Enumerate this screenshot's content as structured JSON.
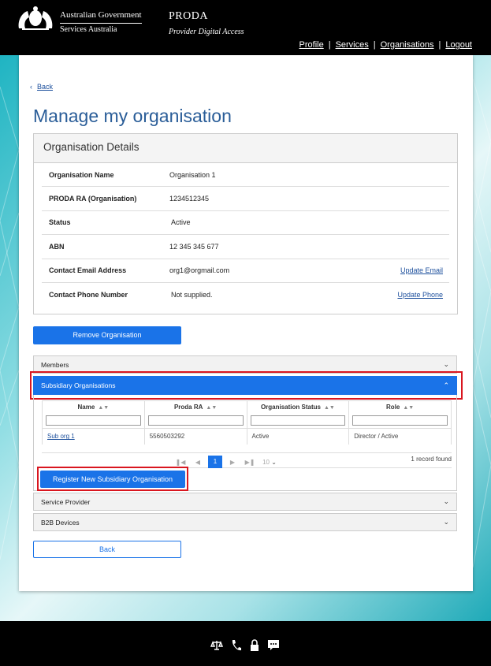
{
  "header": {
    "gov_line1": "Australian Government",
    "gov_line2": "Services Australia",
    "app_title": "PRODA",
    "app_subtitle": "Provider Digital Access",
    "nav": [
      "Profile",
      "Services",
      "Organisations",
      "Logout"
    ]
  },
  "page": {
    "back_link": "Back",
    "title": "Manage my organisation"
  },
  "details": {
    "heading": "Organisation Details",
    "rows": [
      {
        "label": "Organisation Name",
        "value": "Organisation 1",
        "action": ""
      },
      {
        "label": "PRODA RA (Organisation)",
        "value": "1234512345",
        "action": ""
      },
      {
        "label": "Status",
        "value": "Active",
        "action": ""
      },
      {
        "label": "ABN",
        "value": "12 345 345 677",
        "action": ""
      },
      {
        "label": "Contact Email Address",
        "value": "org1@orgmail.com",
        "action": "Update Email"
      },
      {
        "label": "Contact Phone Number",
        "value": "Not supplied.",
        "action": "Update Phone"
      }
    ]
  },
  "remove_button": "Remove Organisation",
  "accordions": {
    "members": "Members",
    "subsidiary": "Subsidiary Organisations",
    "service_provider": "Service Provider",
    "b2b": "B2B Devices"
  },
  "subsidiary_table": {
    "columns": [
      "Name",
      "Proda RA",
      "Organisation Status",
      "Role"
    ],
    "rows": [
      {
        "name": "Sub org 1",
        "proda_ra": "5560503292",
        "status": "Active",
        "role": "Director / Active"
      }
    ],
    "current_page": "1",
    "page_size": "10",
    "records_found": "1 record found"
  },
  "register_button": "Register New Subsidiary Organisation",
  "back_button": "Back",
  "colors": {
    "primary": "#1a73e8",
    "title": "#2a5d98",
    "highlight": "#d9161f",
    "header_bg": "#000000"
  }
}
